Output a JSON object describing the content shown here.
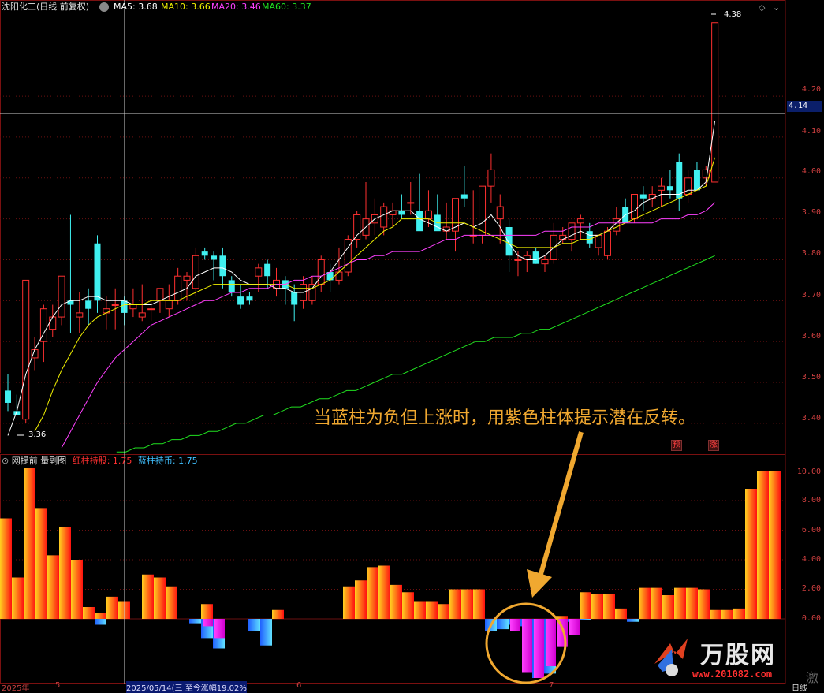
{
  "header": {
    "stock_name": "沈阳化工(日线 前复权)",
    "ma5": "MA5: 3.68",
    "ma10": "MA10: 3.66",
    "ma20": "MA20: 3.46",
    "ma60": "MA60: 3.37",
    "colors": {
      "ma5": "#ffffff",
      "ma10": "#f0f000",
      "ma20": "#ff40ff",
      "ma60": "#20e020"
    }
  },
  "main_axis": {
    "ticks": [
      "4.20",
      "4.10",
      "4.00",
      "3.90",
      "3.80",
      "3.70",
      "3.60",
      "3.50",
      "3.40"
    ],
    "current_price": "4.14",
    "high_marker": "4.38",
    "low_marker": "3.36"
  },
  "sub_panel": {
    "title": "网提前 量副图",
    "red_label": "红柱持股: 1.75",
    "blue_label": "蓝柱持币: 1.75",
    "ticks": [
      "10.00",
      "8.00",
      "6.00",
      "4.00",
      "2.00",
      "0.00"
    ]
  },
  "badges": {
    "left": "预",
    "right": "涨"
  },
  "callout": "当蓝柱为负但上涨时，用紫色柱体提示潜在反转。",
  "bottom_bar": {
    "year": "2025年",
    "m5": "5",
    "date_info": "2025/05/14(三 至今涨幅19.02%",
    "m6": "6",
    "m7": "7",
    "period": "日线"
  },
  "logo": {
    "name": "万股网",
    "url": "www.201082.com",
    "corner": "激"
  },
  "chart_data": [
    {
      "type": "candlestick",
      "title": "沈阳化工(日线 前复权)",
      "ylim": [
        3.34,
        4.42
      ],
      "series": [
        {
          "name": "K",
          "ohlc": [
            [
              3.48,
              3.52,
              3.43,
              3.45
            ],
            [
              3.43,
              3.47,
              3.42,
              3.42
            ],
            [
              3.41,
              3.75,
              3.4,
              3.75
            ],
            [
              3.56,
              3.61,
              3.53,
              3.58
            ],
            [
              3.6,
              3.69,
              3.55,
              3.68
            ],
            [
              3.63,
              3.69,
              3.61,
              3.66
            ],
            [
              3.66,
              3.76,
              3.64,
              3.76
            ],
            [
              3.7,
              3.91,
              3.62,
              3.69
            ],
            [
              3.66,
              3.72,
              3.62,
              3.67
            ],
            [
              3.7,
              3.73,
              3.64,
              3.68
            ],
            [
              3.84,
              3.86,
              3.67,
              3.7
            ],
            [
              3.67,
              3.71,
              3.63,
              3.68
            ],
            [
              3.69,
              3.73,
              3.63,
              3.69
            ],
            [
              3.7,
              3.71,
              3.64,
              3.67
            ],
            [
              3.68,
              3.73,
              3.66,
              3.69
            ],
            [
              3.66,
              3.74,
              3.65,
              3.67
            ],
            [
              3.68,
              3.7,
              3.65,
              3.68
            ],
            [
              3.7,
              3.73,
              3.67,
              3.73
            ],
            [
              3.68,
              3.74,
              3.66,
              3.7
            ],
            [
              3.7,
              3.78,
              3.69,
              3.76
            ],
            [
              3.75,
              3.77,
              3.7,
              3.76
            ],
            [
              3.73,
              3.83,
              3.71,
              3.81
            ],
            [
              3.82,
              3.83,
              3.8,
              3.81
            ],
            [
              3.81,
              3.82,
              3.75,
              3.8
            ],
            [
              3.81,
              3.83,
              3.73,
              3.76
            ],
            [
              3.75,
              3.76,
              3.71,
              3.72
            ],
            [
              3.71,
              3.74,
              3.68,
              3.69
            ],
            [
              3.71,
              3.72,
              3.69,
              3.7
            ],
            [
              3.76,
              3.79,
              3.72,
              3.78
            ],
            [
              3.79,
              3.8,
              3.73,
              3.76
            ],
            [
              3.73,
              3.78,
              3.71,
              3.75
            ],
            [
              3.75,
              3.76,
              3.69,
              3.73
            ],
            [
              3.72,
              3.74,
              3.65,
              3.69
            ],
            [
              3.7,
              3.76,
              3.68,
              3.74
            ],
            [
              3.7,
              3.76,
              3.69,
              3.74
            ],
            [
              3.74,
              3.81,
              3.72,
              3.8
            ],
            [
              3.77,
              3.79,
              3.72,
              3.75
            ],
            [
              3.75,
              3.83,
              3.74,
              3.77
            ],
            [
              3.77,
              3.86,
              3.76,
              3.85
            ],
            [
              3.85,
              3.92,
              3.83,
              3.91
            ],
            [
              3.86,
              3.99,
              3.85,
              3.9
            ],
            [
              3.89,
              3.95,
              3.86,
              3.91
            ],
            [
              3.88,
              3.94,
              3.86,
              3.93
            ],
            [
              3.91,
              3.94,
              3.88,
              3.92
            ],
            [
              3.92,
              3.96,
              3.9,
              3.91
            ],
            [
              3.94,
              3.99,
              3.91,
              3.94
            ],
            [
              3.92,
              4.01,
              3.89,
              3.87
            ],
            [
              3.9,
              3.97,
              3.88,
              3.92
            ],
            [
              3.91,
              3.96,
              3.88,
              3.87
            ],
            [
              3.87,
              3.94,
              3.85,
              3.88
            ],
            [
              3.87,
              3.94,
              3.82,
              3.95
            ],
            [
              3.96,
              4.03,
              3.93,
              3.95
            ],
            [
              3.86,
              3.97,
              3.84,
              3.86
            ],
            [
              3.86,
              3.97,
              3.84,
              3.98
            ],
            [
              3.98,
              4.06,
              3.94,
              4.02
            ],
            [
              3.9,
              3.96,
              3.84,
              3.93
            ],
            [
              3.88,
              3.9,
              3.77,
              3.81
            ],
            [
              3.8,
              3.82,
              3.76,
              3.8
            ],
            [
              3.8,
              3.82,
              3.77,
              3.81
            ],
            [
              3.82,
              3.83,
              3.79,
              3.79
            ],
            [
              3.79,
              3.81,
              3.77,
              3.8
            ],
            [
              3.8,
              3.89,
              3.79,
              3.86
            ],
            [
              3.85,
              3.88,
              3.84,
              3.86
            ],
            [
              3.85,
              3.89,
              3.82,
              3.89
            ],
            [
              3.89,
              3.91,
              3.85,
              3.9
            ],
            [
              3.87,
              3.89,
              3.83,
              3.84
            ],
            [
              3.83,
              3.86,
              3.81,
              3.86
            ],
            [
              3.81,
              3.88,
              3.8,
              3.87
            ],
            [
              3.87,
              3.93,
              3.86,
              3.9
            ],
            [
              3.93,
              3.95,
              3.89,
              3.89
            ],
            [
              3.9,
              3.96,
              3.89,
              3.96
            ],
            [
              3.96,
              3.98,
              3.92,
              3.95
            ],
            [
              3.95,
              3.98,
              3.93,
              3.96
            ],
            [
              3.97,
              4.0,
              3.93,
              3.98
            ],
            [
              3.98,
              4.02,
              3.95,
              3.97
            ],
            [
              4.04,
              4.06,
              3.92,
              3.95
            ],
            [
              3.96,
              4.02,
              3.94,
              4.0
            ],
            [
              4.02,
              4.04,
              3.97,
              3.97
            ],
            [
              4.0,
              4.03,
              3.98,
              4.02
            ],
            [
              3.99,
              4.38,
              3.99,
              4.38
            ]
          ]
        },
        {
          "name": "MA5",
          "values": [
            3.37,
            3.43,
            3.52,
            3.58,
            3.62,
            3.66,
            3.69,
            3.7,
            3.7,
            3.71,
            3.71,
            3.7,
            3.7,
            3.7,
            3.69,
            3.69,
            3.69,
            3.7,
            3.71,
            3.72,
            3.73,
            3.76,
            3.77,
            3.78,
            3.78,
            3.77,
            3.75,
            3.74,
            3.74,
            3.74,
            3.73,
            3.73,
            3.72,
            3.72,
            3.73,
            3.76,
            3.77,
            3.8,
            3.83,
            3.86,
            3.88,
            3.9,
            3.91,
            3.92,
            3.92,
            3.92,
            3.9,
            3.89,
            3.88,
            3.87,
            3.88,
            3.89,
            3.88,
            3.89,
            3.91,
            3.88,
            3.84,
            3.81,
            3.8,
            3.8,
            3.81,
            3.83,
            3.85,
            3.86,
            3.87,
            3.86,
            3.86,
            3.87,
            3.89,
            3.91,
            3.92,
            3.94,
            3.95,
            3.96,
            3.96,
            3.96,
            3.97,
            3.97,
            3.99,
            4.14
          ]
        },
        {
          "name": "MA10",
          "values": [
            null,
            null,
            null,
            3.38,
            3.42,
            3.48,
            3.53,
            3.57,
            3.61,
            3.64,
            3.66,
            3.67,
            3.68,
            3.69,
            3.69,
            3.69,
            3.7,
            3.7,
            3.7,
            3.7,
            3.71,
            3.72,
            3.73,
            3.74,
            3.74,
            3.74,
            3.74,
            3.74,
            3.74,
            3.74,
            3.74,
            3.74,
            3.73,
            3.73,
            3.73,
            3.74,
            3.75,
            3.77,
            3.79,
            3.81,
            3.83,
            3.85,
            3.87,
            3.88,
            3.9,
            3.9,
            3.9,
            3.9,
            3.89,
            3.89,
            3.89,
            3.89,
            3.88,
            3.87,
            3.86,
            3.85,
            3.84,
            3.83,
            3.83,
            3.83,
            3.83,
            3.83,
            3.84,
            3.84,
            3.85,
            3.85,
            3.86,
            3.87,
            3.88,
            3.89,
            3.9,
            3.91,
            3.92,
            3.93,
            3.94,
            3.95,
            3.96,
            3.97,
            3.98,
            4.05
          ]
        },
        {
          "name": "MA20",
          "values": [
            null,
            null,
            null,
            null,
            null,
            null,
            3.34,
            3.38,
            3.42,
            3.46,
            3.5,
            3.53,
            3.56,
            3.58,
            3.6,
            3.62,
            3.64,
            3.65,
            3.66,
            3.67,
            3.68,
            3.69,
            3.7,
            3.7,
            3.71,
            3.72,
            3.72,
            3.73,
            3.73,
            3.73,
            3.74,
            3.74,
            3.75,
            3.75,
            3.76,
            3.76,
            3.77,
            3.78,
            3.79,
            3.8,
            3.8,
            3.81,
            3.81,
            3.82,
            3.82,
            3.82,
            3.82,
            3.83,
            3.84,
            3.85,
            3.85,
            3.86,
            3.86,
            3.86,
            3.86,
            3.86,
            3.86,
            3.86,
            3.86,
            3.86,
            3.87,
            3.87,
            3.87,
            3.88,
            3.88,
            3.88,
            3.89,
            3.89,
            3.89,
            3.89,
            3.89,
            3.89,
            3.89,
            3.9,
            3.9,
            3.9,
            3.91,
            3.91,
            3.92,
            3.94
          ]
        },
        {
          "name": "MA60",
          "values": [
            null,
            null,
            null,
            null,
            null,
            3.33,
            3.33,
            3.34,
            3.34,
            3.35,
            3.35,
            3.36,
            3.36,
            3.37,
            3.37,
            3.38,
            3.38,
            3.39,
            3.4,
            3.4,
            3.41,
            3.42,
            3.42,
            3.43,
            3.44,
            3.44,
            3.45,
            3.46,
            3.46,
            3.47,
            3.48,
            3.48,
            3.49,
            3.5,
            3.51,
            3.52,
            3.52,
            3.53,
            3.54,
            3.55,
            3.56,
            3.57,
            3.58,
            3.59,
            3.6,
            3.6,
            3.61,
            3.61,
            3.61,
            3.62,
            3.62,
            3.63,
            3.63,
            3.64,
            3.65,
            3.66,
            3.67,
            3.68,
            3.69,
            3.7,
            3.71,
            3.72,
            3.73,
            3.74,
            3.75,
            3.76,
            3.77,
            3.78,
            3.79,
            3.8,
            3.81
          ]
        }
      ]
    },
    {
      "type": "bar",
      "title": "网提前 量副图",
      "ylim": [
        -4.0,
        10.5
      ],
      "series": [
        {
          "name": "红柱持股",
          "values": [
            6.8,
            2.8,
            10.2,
            7.5,
            4.3,
            6.2,
            4.0,
            0.8,
            0.4,
            1.5,
            1.2,
            0,
            3.0,
            2.8,
            2.2,
            0,
            0,
            1.0,
            0,
            0,
            0,
            0,
            0,
            0.6,
            0,
            0,
            0,
            0,
            0,
            2.2,
            2.6,
            3.5,
            3.6,
            2.3,
            1.8,
            1.2,
            1.2,
            1.0,
            2.0,
            2.0,
            2.0,
            0,
            0,
            0,
            0,
            0,
            0,
            0.2,
            0,
            1.8,
            1.7,
            1.7,
            0.7,
            0,
            2.1,
            2.1,
            1.6,
            2.1,
            2.1,
            2.0,
            0.6,
            0.6,
            0.7,
            8.8,
            10.0,
            10.0
          ]
        },
        {
          "name": "蓝柱持币",
          "values": [
            0,
            0,
            0,
            0,
            0,
            0,
            0,
            0,
            -0.4,
            0,
            0,
            0,
            0,
            0,
            0,
            0,
            -0.3,
            -1.3,
            -2.0,
            0,
            0,
            -0.8,
            -1.8,
            0,
            0,
            0,
            0,
            0,
            0,
            0,
            0,
            0,
            0,
            0,
            0,
            0,
            0,
            0,
            0,
            0,
            0,
            -0.8,
            -0.7,
            -0.4,
            -0.5,
            -4.0,
            -3.7,
            0,
            -0.2,
            -0.1,
            0,
            0,
            0,
            -0.2,
            0,
            0,
            0,
            0,
            0,
            0,
            0,
            0,
            0,
            0,
            0,
            0
          ]
        },
        {
          "name": "紫色",
          "values": [
            0,
            0,
            0,
            0,
            0,
            0,
            0,
            0,
            0,
            0,
            0,
            0,
            0,
            0,
            0,
            0,
            0,
            -0.5,
            -1.3,
            0,
            0,
            0,
            0,
            0,
            0,
            0,
            0,
            0,
            0,
            0,
            0,
            0,
            0,
            0,
            0,
            0,
            0,
            0,
            0,
            0,
            0,
            0,
            0,
            -0.8,
            -3.6,
            -4.0,
            -3.2,
            -1.9,
            -1.1,
            0,
            0,
            0,
            0,
            0,
            0,
            0,
            0,
            0,
            0,
            0,
            0,
            0,
            0,
            0,
            0,
            0
          ]
        }
      ]
    }
  ]
}
